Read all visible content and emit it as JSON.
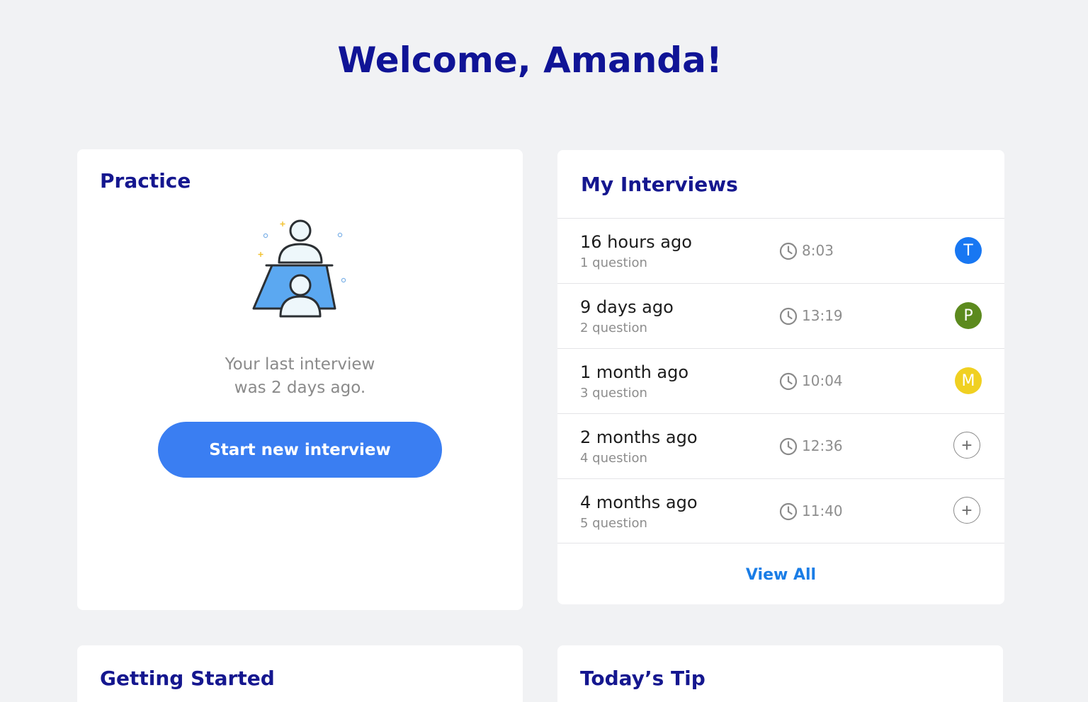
{
  "header": {
    "welcome": "Welcome, Amanda!"
  },
  "practice": {
    "title": "Practice",
    "last_interview_line1": "Your last interview",
    "last_interview_line2": "was 2 days ago.",
    "start_button": "Start new interview",
    "illustration_icon": "interview-people-icon"
  },
  "interviews": {
    "title": "My Interviews",
    "rows": [
      {
        "when": "16 hours ago",
        "count": "1 question",
        "duration": "8:03",
        "avatar": "T",
        "avatar_color": "#1877f2"
      },
      {
        "when": "9 days ago",
        "count": "2 question",
        "duration": "13:19",
        "avatar": "P",
        "avatar_color": "#5c8a1e"
      },
      {
        "when": "1 month ago",
        "count": "3 question",
        "duration": "10:04",
        "avatar": "M",
        "avatar_color": "#f0d021"
      },
      {
        "when": "2 months ago",
        "count": "4 question",
        "duration": "12:36",
        "avatar": "+",
        "avatar_color": ""
      },
      {
        "when": "4 months ago",
        "count": "5 question",
        "duration": "11:40",
        "avatar": "+",
        "avatar_color": ""
      }
    ],
    "view_all": "View All",
    "clock_icon": "clock-icon"
  },
  "getting_started": {
    "title": "Getting Started"
  },
  "tip": {
    "title": "Today’s Tip"
  },
  "colors": {
    "background": "#f1f2f4",
    "title": "#15178f",
    "accent": "#3a7ef2",
    "link": "#1a7de6"
  }
}
